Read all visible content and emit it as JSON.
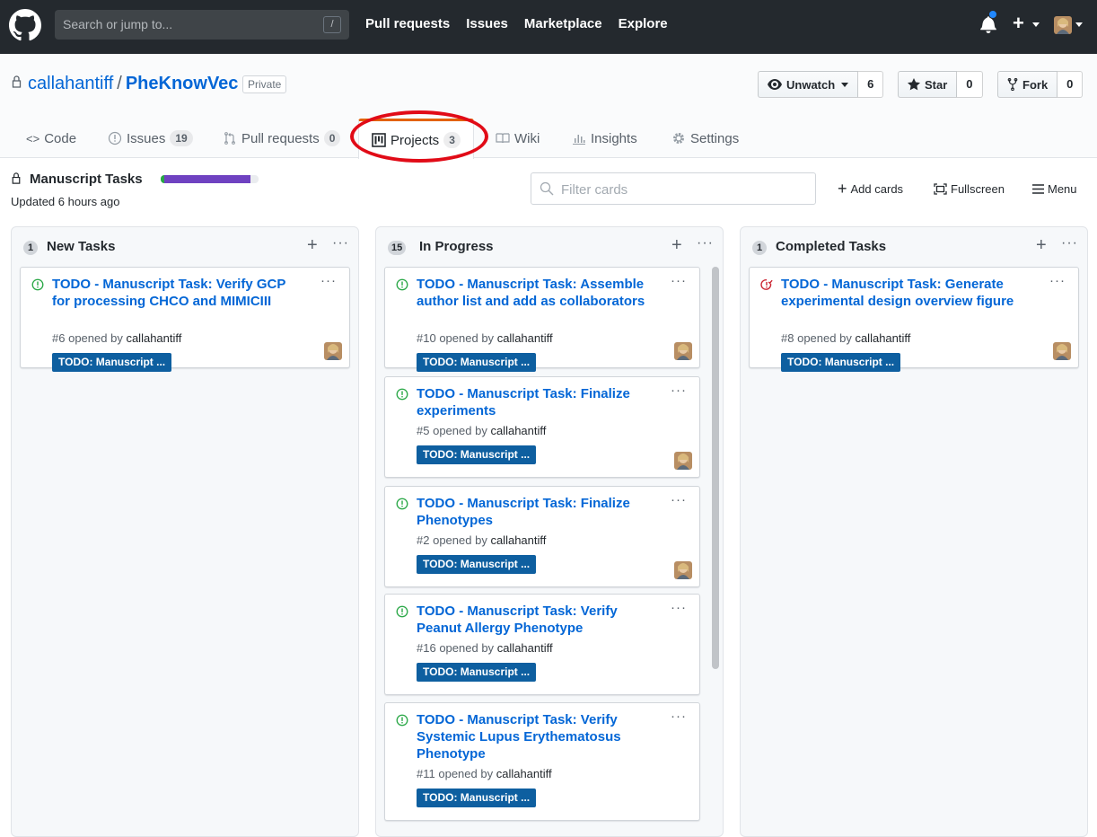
{
  "header": {
    "search_placeholder": "Search or jump to...",
    "search_shortcut": "/",
    "nav": [
      "Pull requests",
      "Issues",
      "Marketplace",
      "Explore"
    ],
    "plus": "+"
  },
  "repo": {
    "owner": "callahantiff",
    "separator": "/",
    "name": "PheKnowVec",
    "visibility": "Private",
    "watch": {
      "label": "Unwatch",
      "count": "6"
    },
    "star": {
      "label": "Star",
      "count": "0"
    },
    "fork": {
      "label": "Fork",
      "count": "0"
    }
  },
  "tabs": [
    {
      "label": "Code",
      "count": ""
    },
    {
      "label": "Issues",
      "count": "19"
    },
    {
      "label": "Pull requests",
      "count": "0"
    },
    {
      "label": "Projects",
      "count": "3"
    },
    {
      "label": "Wiki",
      "count": ""
    },
    {
      "label": "Insights",
      "count": ""
    },
    {
      "label": "Settings",
      "count": ""
    }
  ],
  "project": {
    "name": "Manuscript Tasks",
    "updated": "Updated 6 hours ago",
    "progress": {
      "done_fraction": 0.04,
      "in_progress_fraction": 0.88
    },
    "filter_placeholder": "Filter cards",
    "actions": [
      "Add cards",
      "Fullscreen",
      "Menu"
    ]
  },
  "columns": [
    {
      "count": "1",
      "title": "New Tasks",
      "cards": [
        {
          "title": "TODO - Manuscript Task: Verify GCP for processing CHCO and MIMICIII",
          "number": "#6",
          "opened_by": "opened by",
          "user": "callahantiff",
          "label": "TODO: Manuscript ...",
          "state": "open"
        }
      ]
    },
    {
      "count": "15",
      "title": "In Progress",
      "cards": [
        {
          "title": "TODO - Manuscript Task: Assemble author list and add as collaborators",
          "number": "#10",
          "opened_by": "opened by",
          "user": "callahantiff",
          "label": "TODO: Manuscript ...",
          "state": "open"
        },
        {
          "title": "TODO - Manuscript Task: Finalize experiments",
          "number": "#5",
          "opened_by": "opened by",
          "user": "callahantiff",
          "label": "TODO: Manuscript ...",
          "state": "open"
        },
        {
          "title": "TODO - Manuscript Task: Finalize Phenotypes",
          "number": "#2",
          "opened_by": "opened by",
          "user": "callahantiff",
          "label": "TODO: Manuscript ...",
          "state": "open"
        },
        {
          "title": "TODO - Manuscript Task: Verify Peanut Allergy Phenotype",
          "number": "#16",
          "opened_by": "opened by",
          "user": "callahantiff",
          "label": "TODO: Manuscript ...",
          "state": "open"
        },
        {
          "title": "TODO - Manuscript Task: Verify Systemic Lupus Erythematosus Phenotype",
          "number": "#11",
          "opened_by": "opened by",
          "user": "callahantiff",
          "label": "TODO: Manuscript ...",
          "state": "open"
        }
      ]
    },
    {
      "count": "1",
      "title": "Completed Tasks",
      "cards": [
        {
          "title": "TODO - Manuscript Task: Generate experimental design overview figure",
          "number": "#8",
          "opened_by": "opened by",
          "user": "callahantiff",
          "label": "TODO: Manuscript ...",
          "state": "closed"
        }
      ]
    }
  ],
  "colors": {
    "link": "#0366d6",
    "open": "#28a745",
    "closed": "#cb2431",
    "label_bg": "#0e5fa0",
    "highlight": "#e10b17"
  }
}
